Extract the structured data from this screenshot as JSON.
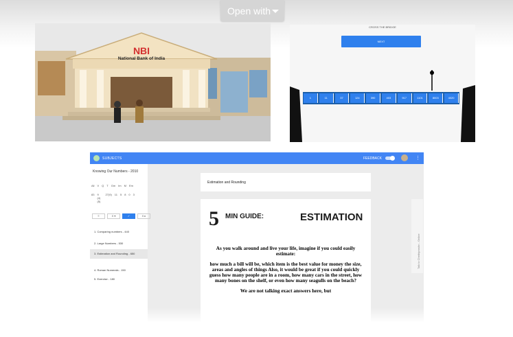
{
  "header": {
    "open_with_label": "Open with"
  },
  "thumb_bank": {
    "sign_letters": "NBI",
    "sign_name": "National Bank of India"
  },
  "thumb_line": {
    "caption": "CROSS THE BRIDGE",
    "button_label": "NEXT",
    "bridge_values": [
      "1",
      "11",
      "37",
      "124",
      "390",
      "403",
      "917",
      "1101",
      "8003",
      "4020"
    ]
  },
  "app": {
    "topbar": {
      "subjects_label": "SUBJECTS",
      "feedback_label": "FEEDBACK",
      "more_icon": "⋮"
    },
    "sidebar": {
      "title": "Knowing Our Numbers - 2010",
      "stat_headers": [
        "All",
        "V",
        "Q",
        "T",
        "Gm",
        "Im",
        "M",
        "Em"
      ],
      "stat_values": [
        "83",
        "9 (4)(5)",
        "27(9)",
        "11",
        "5",
        "8",
        "0",
        "3"
      ],
      "buttons": [
        "≡",
        "X ▾",
        "✓",
        "X ▸"
      ],
      "items": [
        "1. Comparing numbers - 440",
        "2. Large Numbers - 530",
        "3. Estimation and Rounding - 650",
        "4. Roman Numerals - 150",
        "5. Exercise - 180"
      ]
    },
    "content_title": "Estimation and Rounding",
    "doc": {
      "number": "5",
      "subtitle": "MIN GUIDE:",
      "heading": "ESTIMATION",
      "p1": "As you walk around and live your life, imagine if you could easily estimate:",
      "p2": "how much a bill will be, which item is the best value for money the size, areas and angles of things Also, it would be great if you could quickly guess how many people are in a room, how many cars in the street, how many bones on the shelf, or even how many seagulls on the beach?",
      "p3": "We are not talking exact answers here, but"
    },
    "side_tab_label": "Talk to Chetbiprashn - Online"
  }
}
